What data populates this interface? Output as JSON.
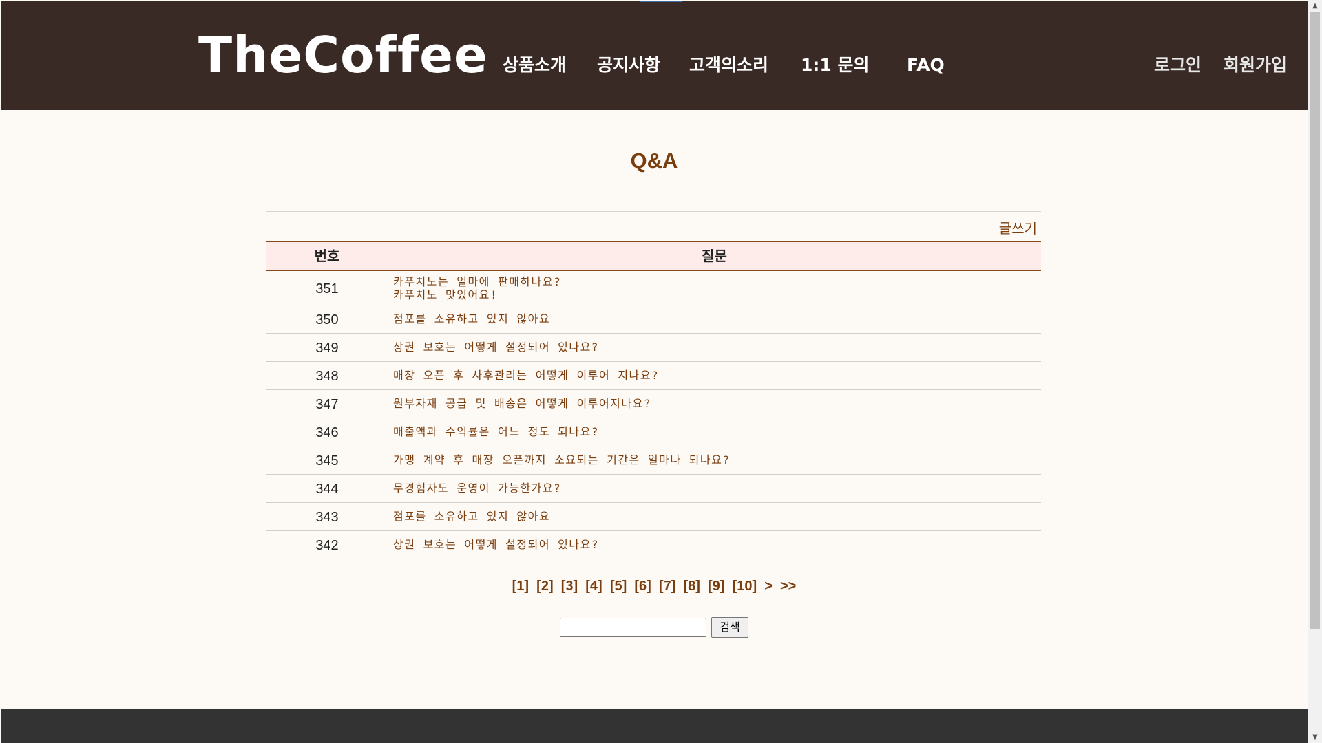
{
  "header": {
    "logo": "TheCoffee",
    "nav": [
      "상품소개",
      "공지사항",
      "고객의소리",
      "1:1 문의",
      "FAQ"
    ],
    "auth": [
      "로그인",
      "회원가입"
    ]
  },
  "board": {
    "title": "Q&A",
    "write_label": "글쓰기",
    "columns": [
      "번호",
      "질문"
    ],
    "rows": [
      {
        "num": "351",
        "q": "카푸치노는 얼마에 판매하나요?",
        "q2": "카푸치노 맛있어요!"
      },
      {
        "num": "350",
        "q": "점포를 소유하고 있지 않아요"
      },
      {
        "num": "349",
        "q": "상권 보호는 어떻게 설정되어 있나요?"
      },
      {
        "num": "348",
        "q": "매장 오픈 후 사후관리는 어떻게 이루어 지나요?"
      },
      {
        "num": "347",
        "q": "원부자재 공급 및 배송은 어떻게 이루어지나요?"
      },
      {
        "num": "346",
        "q": "매출액과 수익률은 어느 정도 되나요?"
      },
      {
        "num": "345",
        "q": "가맹 계약 후 매장 오픈까지 소요되는 기간은 얼마나 되나요?"
      },
      {
        "num": "344",
        "q": "무경험자도 운영이 가능한가요?"
      },
      {
        "num": "343",
        "q": "점포를 소유하고 있지 않아요"
      },
      {
        "num": "342",
        "q": "상권 보호는 어떻게 설정되어 있나요?"
      }
    ]
  },
  "pagination": [
    "[1]",
    "[2]",
    "[3]",
    "[4]",
    "[5]",
    "[6]",
    "[7]",
    "[8]",
    "[9]",
    "[10]",
    ">",
    ">>"
  ],
  "search": {
    "value": "",
    "button_label": "검색"
  },
  "scrollbar": {
    "up_icon": "▲",
    "down_icon": "▼"
  },
  "colors": {
    "header_bg": "#3a2a26",
    "accent_brown": "#7a3d0e",
    "table_head_bg": "#fdecea",
    "page_bg": "#fdfaf6",
    "footer_bg": "#333333"
  }
}
